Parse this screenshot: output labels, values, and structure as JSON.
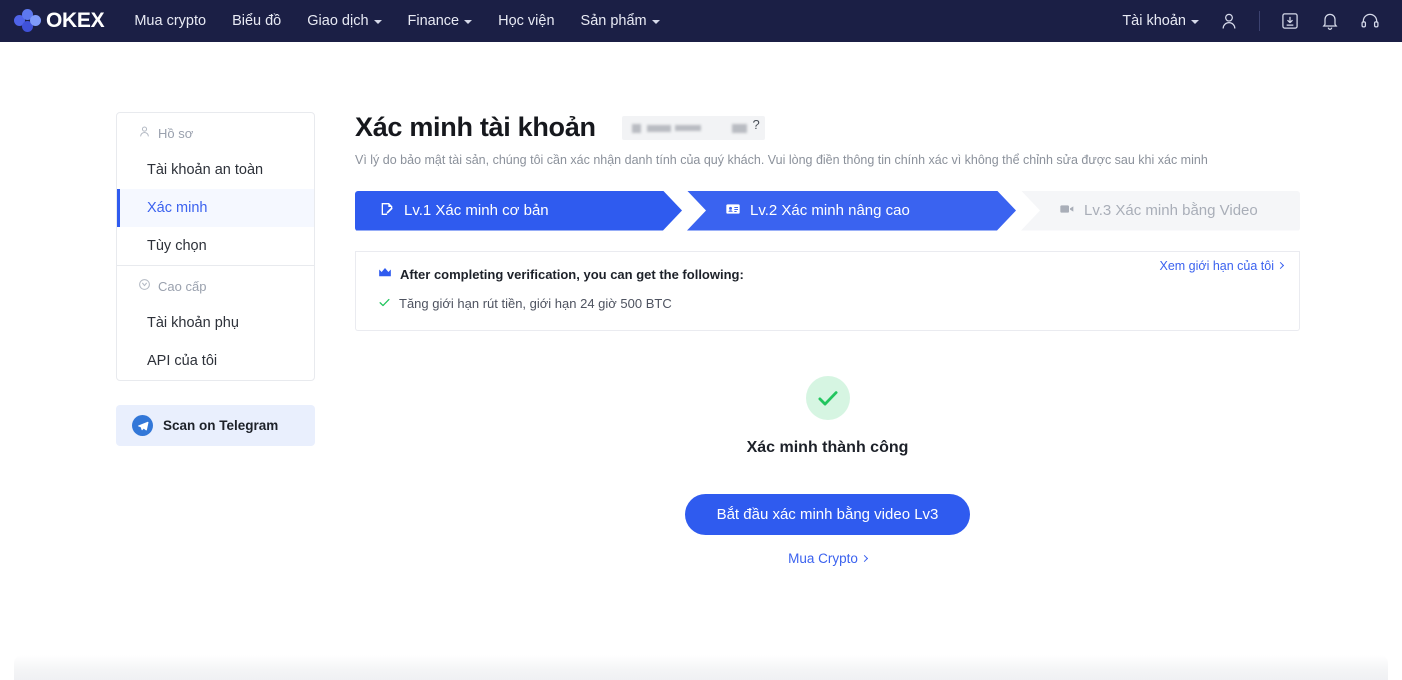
{
  "navbar": {
    "brand": "OKEX",
    "links": [
      {
        "label": "Mua crypto",
        "has_caret": false
      },
      {
        "label": "Biểu đồ",
        "has_caret": false
      },
      {
        "label": "Giao dịch",
        "has_caret": true
      },
      {
        "label": "Finance",
        "has_caret": true
      },
      {
        "label": "Học viện",
        "has_caret": false
      },
      {
        "label": "Sản phẩm",
        "has_caret": true
      }
    ],
    "account_label": "Tài khoản",
    "icons": [
      "user-icon",
      "download-icon",
      "bell-icon",
      "headset-icon"
    ]
  },
  "sidebar": {
    "group1_title": "Hồ sơ",
    "group1_icon": "user-outline-icon",
    "group1_items": [
      {
        "label": "Tài khoản an toàn",
        "active": false
      },
      {
        "label": "Xác minh",
        "active": true
      },
      {
        "label": "Tùy chọn",
        "active": false
      }
    ],
    "group2_title": "Cao cấp",
    "group2_icon": "shield-icon",
    "group2_items": [
      {
        "label": "Tài khoản phụ",
        "active": false
      },
      {
        "label": "API của tôi",
        "active": false
      }
    ],
    "telegram_label": "Scan on Telegram",
    "telegram_icon": "telegram-icon"
  },
  "main": {
    "title": "Xác minh tài khoản",
    "redacted_badge_suffix": "?",
    "subtitle": "Vì lý do bảo mật tài sản, chúng tôi cần xác nhận danh tính của quý khách. Vui lòng điền thông tin chính xác vì không thể chỉnh sửa được sau khi xác minh",
    "steps": [
      {
        "label": "Lv.1 Xác minh cơ bản",
        "icon": "document-edit-icon",
        "state": "complete"
      },
      {
        "label": "Lv.2 Xác minh nâng cao",
        "icon": "id-card-icon",
        "state": "active"
      },
      {
        "label": "Lv.3 Xác minh bằng Video",
        "icon": "video-camera-icon",
        "state": "inactive"
      }
    ],
    "benefits": {
      "heading": "After completing verification, you can get the following:",
      "heading_icon": "crown-icon",
      "items": [
        {
          "icon": "check-icon",
          "text": "Tăng giới hạn rút tiền, giới hạn 24 giờ 500 BTC"
        }
      ],
      "limit_link": "Xem giới hạn của tôi"
    },
    "success": {
      "icon": "check-circle-icon",
      "title": "Xác minh thành công",
      "cta_label": "Bắt đầu xác minh bằng video Lv3",
      "secondary_link": "Mua Crypto"
    }
  },
  "colors": {
    "nav_bg": "#1b1f45",
    "primary": "#2f5bef",
    "link": "#3b62ef",
    "success_green": "#22c55e",
    "success_bg": "#d6f5e2",
    "inactive_step_bg": "#f5f6f8",
    "inactive_step_text": "#a9aeb8"
  }
}
